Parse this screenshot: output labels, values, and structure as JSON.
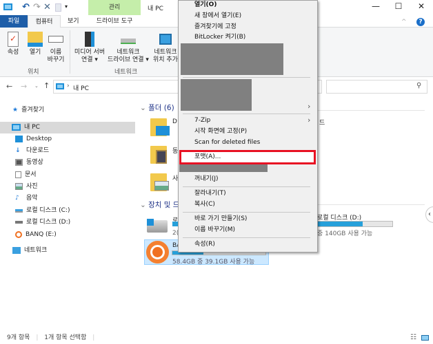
{
  "window": {
    "title": "내 PC",
    "context_tab_group": "관리"
  },
  "ribbon_tabs": [
    "파일",
    "컴퓨터",
    "보기",
    "드라이브 도구"
  ],
  "ribbon": {
    "location_group": "위치",
    "network_group": "네트워크",
    "buttons": [
      {
        "label1": "속성",
        "label2": ""
      },
      {
        "label1": "열기",
        "label2": ""
      },
      {
        "label1": "이름",
        "label2": "바꾸기"
      },
      {
        "label1": "미디어 서버",
        "label2": "연결 ▾"
      },
      {
        "label1": "네트워크",
        "label2": "드라이브 연결 ▾"
      },
      {
        "label1": "네트워크",
        "label2": "위치 추가"
      }
    ]
  },
  "address": {
    "path": "내 PC",
    "search_placeholder": ""
  },
  "nav": {
    "quick_access": "즐겨찾기",
    "this_pc": "내 PC",
    "items": [
      "Desktop",
      "다운로드",
      "동영상",
      "문서",
      "사진",
      "음악",
      "로컬 디스크 (C:)",
      "로컬 디스크 (D:)",
      "BANQ (E:)"
    ],
    "network": "네트워크"
  },
  "content": {
    "folders_header": "폴더 (6)",
    "folder_peek": [
      "D",
      "동",
      "사"
    ],
    "folder_right_peek": "드",
    "devices_header": "장치 및 드라이브",
    "drive_c_peek": "로",
    "drive_c_size_peek": "2(",
    "drive_d_name": "로컬 디스크 (D:)",
    "drive_d_space": "중 140GB 사용 가능",
    "drive_d_used": 0.62,
    "banq_peek": "BA",
    "banq_space": "58.4GB 중 39.1GB 사용 가능",
    "banq_used": 0.33
  },
  "context_menu": {
    "items_top": [
      "열기(O)",
      "새 창에서 열기(E)",
      "즐겨찾기에 고정",
      "BitLocker 켜기(B)"
    ],
    "items_mid": [
      "7-Zip",
      "시작 화면에 고정(P)",
      "Scan for deleted files"
    ],
    "highlighted": "포맷(A)...",
    "eject": "꺼내기(J)",
    "clip": [
      "잘라내기(T)",
      "복사(C)"
    ],
    "link": [
      "바로 가기 만들기(S)",
      "이름 바꾸기(M)"
    ],
    "props": "속성(R)",
    "highlight_color": "#e81123"
  },
  "status": {
    "count": "9개 항목",
    "selected": "1개 항목 선택함"
  }
}
